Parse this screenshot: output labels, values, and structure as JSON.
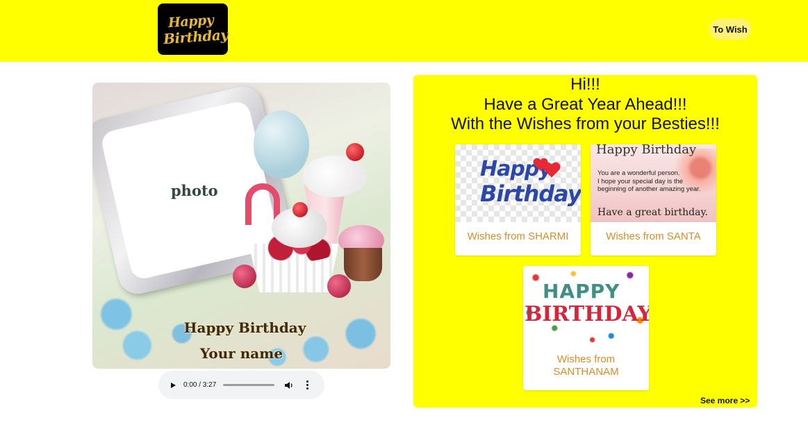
{
  "header": {
    "logo": {
      "line1": "Happy",
      "line2": "Birthday"
    },
    "to_wish_label": "To Wish"
  },
  "card": {
    "photo_label": "photo",
    "greeting_line": "Happy Birthday",
    "name_line": "Your name"
  },
  "audio": {
    "time": "0:00 / 3:27"
  },
  "panel": {
    "greeting_lines": [
      "Hi!!!",
      "Have a Great Year Ahead!!!",
      "With the Wishes from your Besties!!!"
    ],
    "tiles": [
      {
        "caption": "Wishes from SHARMI",
        "image_text": {
          "line1": "Happy",
          "line2": "Birthday"
        }
      },
      {
        "caption": "Wishes from SANTA",
        "image_text": {
          "title": "Happy Birthday",
          "message": [
            "You are a wonderful person.",
            "I hope your special day is the",
            "beginning of another amazing year."
          ],
          "footer": "Have a great birthday."
        }
      },
      {
        "caption_lines": [
          "Wishes from",
          "SANTHANAM"
        ],
        "image_text": {
          "line1": "HAPPY",
          "line2": "BIRTHDAY"
        }
      }
    ],
    "see_more": "See more >>"
  },
  "colors": {
    "header_bg": "#ffff00",
    "panel_bg": "#ffff00",
    "caption": "#d98c24"
  },
  "icons": [
    "play-icon",
    "volume-icon",
    "more-vert-icon",
    "heart-icon"
  ]
}
